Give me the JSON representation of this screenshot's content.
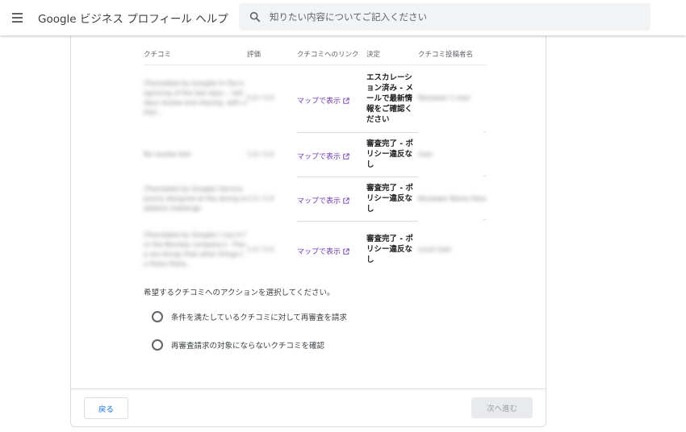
{
  "header": {
    "app_title": "Google ビジネス プロフィール ヘルプ",
    "search_placeholder": "知りたい内容についてご記入ください"
  },
  "table": {
    "columns": [
      "クチコミ",
      "評価",
      "クチコミへのリンク",
      "決定",
      "クチコミ投稿者名"
    ],
    "rows": [
      {
        "review": "(Translated by Google) In the beginning of the last days... last days review and sharing, with other...",
        "rating": "5.0 / 5.0",
        "link": "マップで表示",
        "decision": "エスカレーション済み - メールで最新情報をご確認ください",
        "reviewer": "Reviewer 1 User"
      },
      {
        "review": "No review text",
        "rating": "1.0 / 5.0",
        "link": "マップで表示",
        "decision": "審査完了 - ポリシー違反なし",
        "reviewer": "User"
      },
      {
        "review": "(Translated by Google) Service poorly designed at the wrong weekend challenge",
        "rating": "2.0 / 5.0",
        "link": "マップで表示",
        "decision": "審査完了 - ポリシー違反なし",
        "reviewer": "Reviewer Name Here"
      },
      {
        "review": "(Translated by Google) I use it for the Monday company's. There are things that other things to there there...",
        "rating": "1.0 / 5.0",
        "link": "マップで表示",
        "decision": "審査完了 - ポリシー違反なし",
        "reviewer": "Local User"
      }
    ]
  },
  "actions": {
    "prompt": "希望するクチコミへのアクションを選択してください。",
    "options": [
      "条件を満たしているクチコミに対して再審査を請求",
      "再審査請求の対象にならないクチコミを確認"
    ]
  },
  "footer": {
    "back_label": "戻る",
    "next_label": "次へ進む"
  },
  "colors": {
    "link": "#6f3bb0",
    "primary": "#1a73e8",
    "disabled_bg": "#e8eaed",
    "disabled_text": "#9aa0a6"
  }
}
